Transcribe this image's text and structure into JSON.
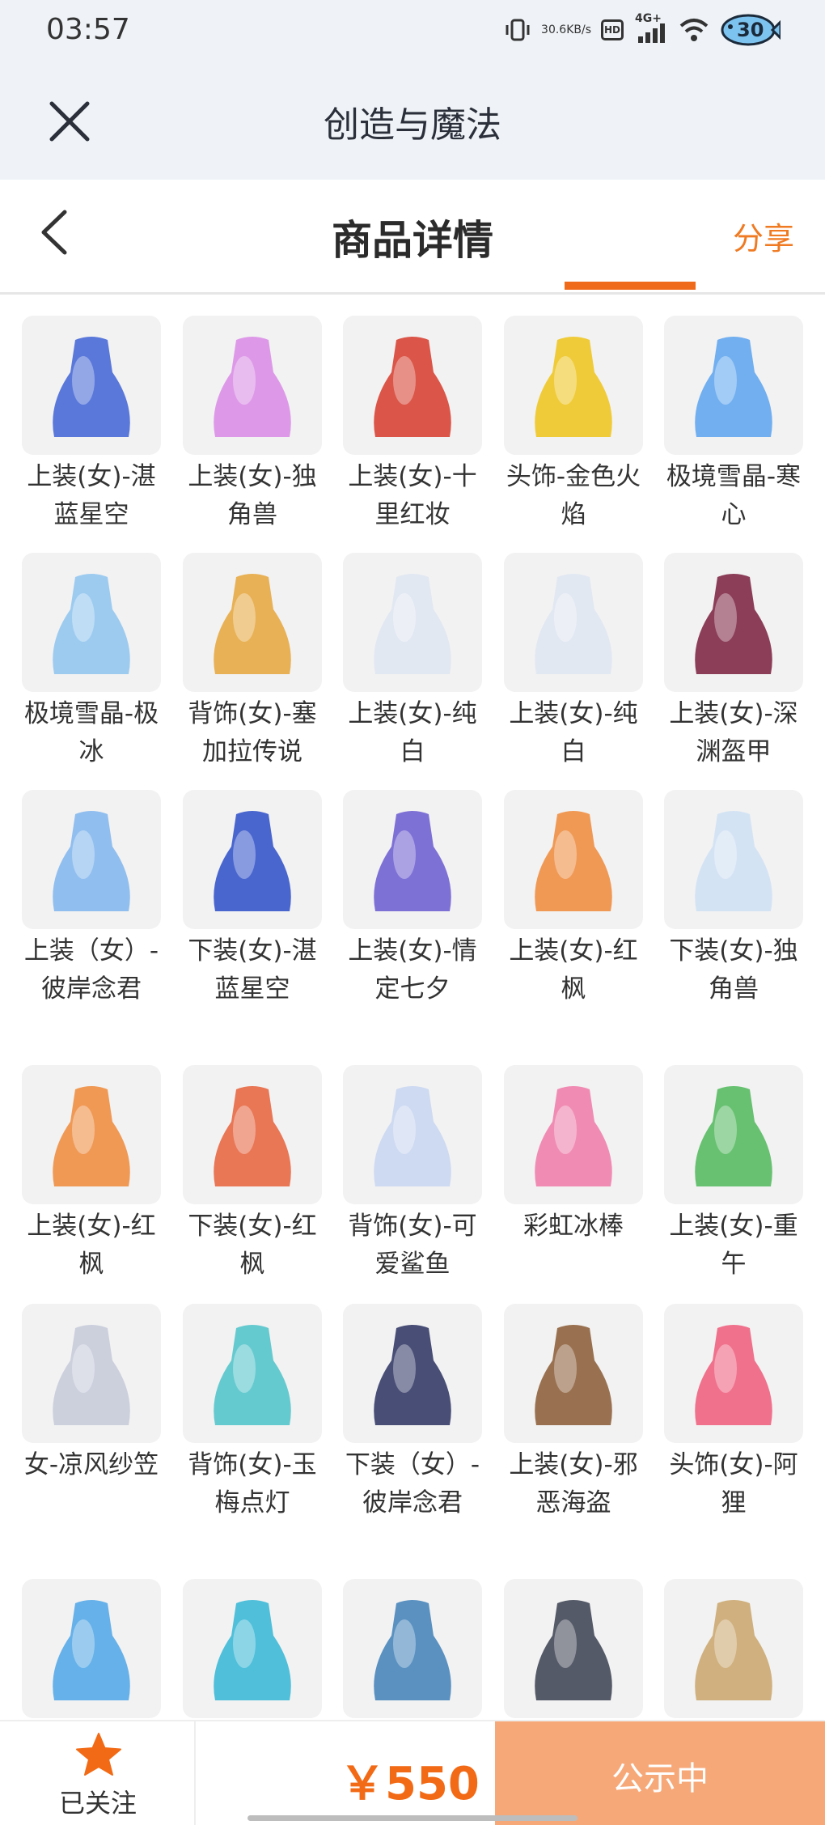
{
  "status_bar": {
    "time": "03:57",
    "net_speed_value": "30.6",
    "net_speed_unit": "KB/s",
    "hd_label": "HD",
    "cell_label": "4G+",
    "battery": "30"
  },
  "app_header": {
    "title": "创造与魔法",
    "close_icon": "close-icon"
  },
  "nav": {
    "title": "商品详情",
    "share": "分享",
    "back_icon": "back-icon"
  },
  "items": [
    {
      "label": "上装(女)-湛蓝星空",
      "color": "#3f63d6"
    },
    {
      "label": "上装(女)-独角兽",
      "color": "#d98ae6"
    },
    {
      "label": "上装(女)-十里红妆",
      "color": "#d73a2a"
    },
    {
      "label": "头饰-金色火焰",
      "color": "#f0c419"
    },
    {
      "label": "极境雪晶-寒心",
      "color": "#5aa3f0"
    },
    {
      "label": "极境雪晶-极冰",
      "color": "#8ec4f0"
    },
    {
      "label": "背饰(女)-塞加拉传说",
      "color": "#e6a63a"
    },
    {
      "label": "上装(女)-纯白",
      "color": "#dfe6f2"
    },
    {
      "label": "上装(女)-纯白",
      "color": "#dfe6f2"
    },
    {
      "label": "上装(女)-深渊盔甲",
      "color": "#7a1f3d"
    },
    {
      "label": "上装（女）-彼岸念君",
      "color": "#7fb5ef"
    },
    {
      "label": "下装(女)-湛蓝星空",
      "color": "#2b4ec9"
    },
    {
      "label": "上装(女)-情定七夕",
      "color": "#6a5ad1"
    },
    {
      "label": "上装(女)-红枫",
      "color": "#f08a3a"
    },
    {
      "label": "下装(女)-独角兽",
      "color": "#cfe0f5"
    },
    {
      "label": "上装(女)-红枫",
      "color": "#f08a3a"
    },
    {
      "label": "下装(女)-红枫",
      "color": "#e8603a"
    },
    {
      "label": "背饰(女)-可爱鲨鱼",
      "color": "#c8d6f2"
    },
    {
      "label": "彩虹冰棒",
      "color": "#f07aa8"
    },
    {
      "label": "上装(女)-重午",
      "color": "#4fb85a"
    },
    {
      "label": "女-凉风纱笠",
      "color": "#c6cad9"
    },
    {
      "label": "背饰(女)-玉梅点灯",
      "color": "#4cc3c9"
    },
    {
      "label": "下装（女）-彼岸念君",
      "color": "#2a3160"
    },
    {
      "label": "上装(女)-邪恶海盗",
      "color": "#8a5a34"
    },
    {
      "label": "头饰(女)-阿狸",
      "color": "#f05a7a"
    },
    {
      "label": "",
      "color": "#4da6e8"
    },
    {
      "label": "",
      "color": "#33b6d6"
    },
    {
      "label": "",
      "color": "#3f80b8"
    },
    {
      "label": "",
      "color": "#3a4050"
    },
    {
      "label": "",
      "color": "#c9a56a"
    }
  ],
  "bottom_bar": {
    "follow_label": "已关注",
    "price": "￥550",
    "status_label": "公示中"
  }
}
